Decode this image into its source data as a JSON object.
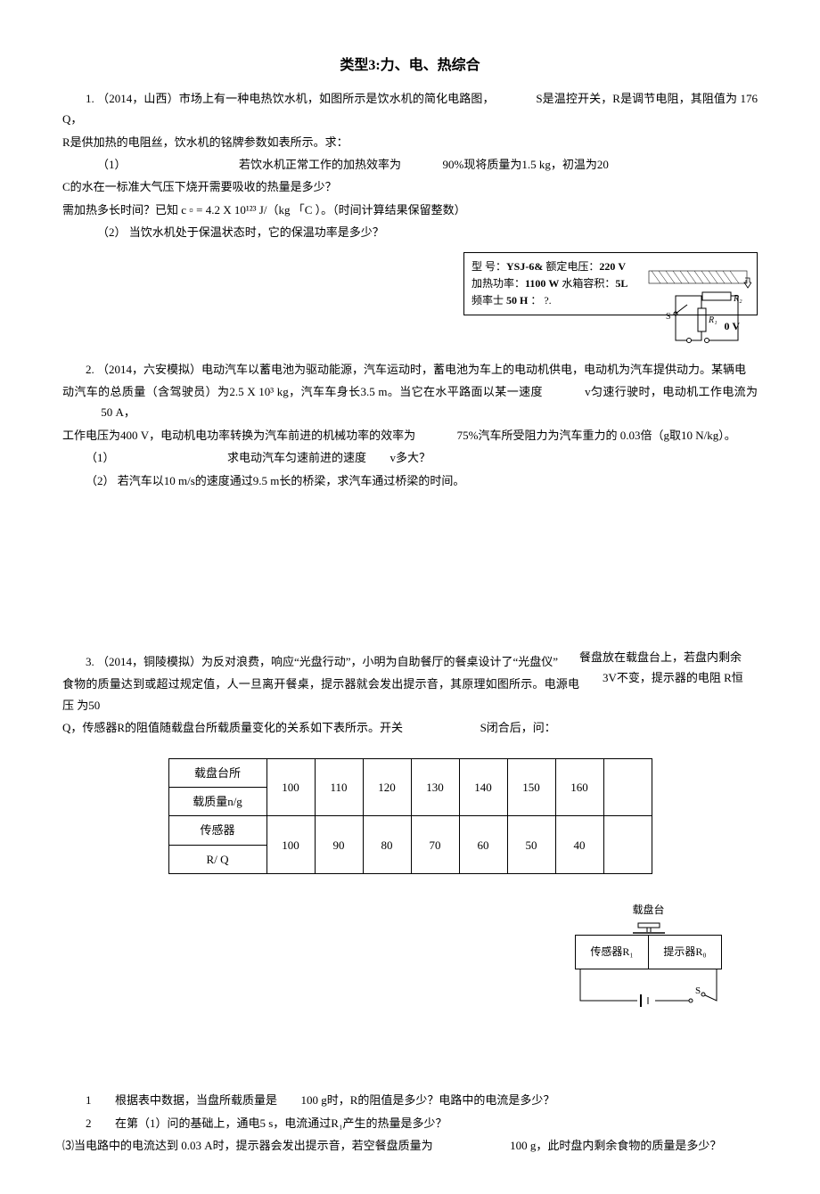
{
  "title": "类型3:力、电、热综合",
  "q1": {
    "line1_a": "1.  （2014，山西）市场上有一种电热饮水机，如图所示是饮水机的简化电路图，",
    "line1_b": "S是温控开关，R是调节电阻，其阻值为 176 Q，",
    "line2": "R是供加热的电阻丝，饮水机的铭牌参数如表所示。求：",
    "line3_a": "（1）",
    "line3_b": "若饮水机正常工作的加热效率为",
    "line3_c": "90%现将质量为1.5 kg，初温为20",
    "line4": "C的水在一标准大气压下烧开需要吸收的热量是多少？",
    "line5": "需加热多长时间？已知 c ▫ = 4.2 X 10¹²³ J/（kg 「C ）。（时间计算结果保留整数）",
    "line6": "（2） 当饮水机处于保温状态时，它的保温功率是多少？",
    "box_spec": "型 号：YSJ-6& 额定电压：220 V 加热功率：1100 W 水箱容积：5L 频率士 50 H ： ?.",
    "box_s": "S",
    "box_r1": "R₁",
    "box_r2": "R₂",
    "box_0v": "0 V"
  },
  "q2": {
    "line1_a": "2.  （2014，六安模拟）电动汽车以蓄电池为驱动能源，汽车运动时，蓄电池为车上的电动机供电，电动机为汽车提供动力。某辆电",
    "line2_a": "动汽车的总质量（含驾驶员）为2.5 X 10³ kg，汽车车身长3.5 m。当它在水平路面以某一速度",
    "line2_b": "v匀速行驶时，电动机工作电流为",
    "line2_c": "50 A，",
    "line3_a": "工作电压为400 V，电动机电功率转换为汽车前进的机械功率的效率为",
    "line3_b": "75%汽车所受阻力为汽车重力的 0.03倍（g取10 N/kg）。",
    "line4_a": "（1）",
    "line4_b": "求电动汽车匀速前进的速度",
    "line4_c": "v多大？",
    "line5": "（2） 若汽车以10 m/s的速度通过9.5 m长的桥梁，求汽车通过桥梁的时间。"
  },
  "q3": {
    "right_a": "餐盘放在载盘台上，若盘内剩余",
    "right_b": "3V不变，提示器的电阻 R恒",
    "line1": "3.  （2014，铜陵模拟）为反对浪费，响应“光盘行动”，小明为自助餐厅的餐桌设计了“光盘仪”",
    "line2": "食物的质量达到或超过规定值，人一旦离开餐桌，提示器就会发出提示音，其原理如图所示。电源电压 为50",
    "line3_a": "Q，传感器R的阻值随载盘台所载质量变化的关系如下表所示。开关",
    "line3_b": "S闭合后，问：",
    "table": {
      "row1_hdr_a": "载盘台所",
      "row1_hdr_b": "载质量n/g",
      "row1": [
        "100",
        "110",
        "120",
        "130",
        "140",
        "150",
        "160"
      ],
      "row2_hdr_a": "传感器",
      "row2_hdr_b": "R/ Q",
      "row2": [
        "100",
        "90",
        "80",
        "70",
        "60",
        "50",
        "40"
      ]
    },
    "circ_top": "载盘台",
    "circ_left": "传感器R₁",
    "circ_right": "提示器R₀",
    "circ_s": "S",
    "sub1_a": "1",
    "sub1_b": "根据表中数据，当盘所载质量是",
    "sub1_c": "100 g时，R的阻值是多少？电路中的电流是多少？",
    "sub2_a": "2",
    "sub2_b": "在第（1）问的基础上，通电5 s，电流通过R₁产生的热量是多少？",
    "sub3_a": "⑶当电路中的电流达到 0.03 A时，提示器会发出提示音，若空餐盘质量为",
    "sub3_b": "100 g，此时盘内剩余食物的质量是多少？"
  },
  "chart_data": {
    "type": "table",
    "title": "传感器R的阻值随载盘台所载质量变化的关系",
    "rows_header": [
      "载盘台所载质量n/g",
      "传感器 R/Q"
    ],
    "columns": [
      100,
      110,
      120,
      130,
      140,
      150,
      160
    ],
    "values": [
      100,
      90,
      80,
      70,
      60,
      50,
      40
    ]
  }
}
